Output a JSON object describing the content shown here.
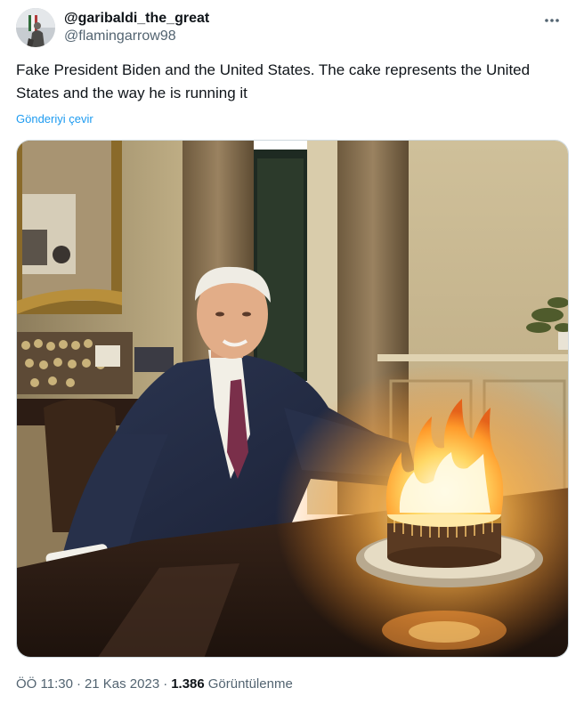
{
  "tweet": {
    "display_name": "@garibaldi_the_great",
    "handle": "@flamingarrow98",
    "text": "Fake President Biden and the United States. The cake represents the United States and the way he is running it",
    "translate_label": "Gönderiyi çevir",
    "time": "ÖÖ 11:30",
    "date": "21 Kas 2023",
    "separator": "·",
    "views_count": "1.386",
    "views_label": "Görüntülenme"
  },
  "icons": {
    "more": "more-dots-icon",
    "avatar": "avatar-image"
  },
  "colors": {
    "link": "#1d9bf0",
    "secondary_text": "#536471",
    "primary_text": "#0f1419"
  }
}
